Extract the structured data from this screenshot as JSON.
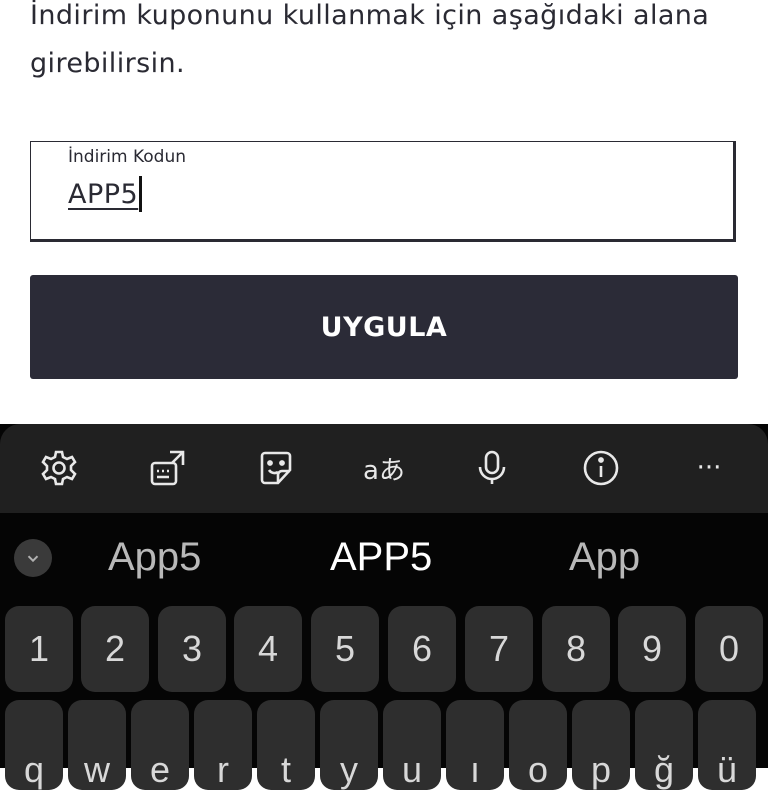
{
  "description": "İndirim kuponunu kullanmak için aşağıdaki alana girebilirsin.",
  "coupon_field": {
    "label": "İndirim Kodun",
    "value": "APP5"
  },
  "apply_button": {
    "label": "UYGULA"
  },
  "keyboard": {
    "toolbar": [
      "settings-icon",
      "keyboard-resize-icon",
      "sticker-icon",
      "translate-icon",
      "microphone-icon",
      "info-icon",
      "more-icon"
    ],
    "translate_label": "aあ",
    "more_label": "···",
    "suggestions": {
      "left": "App5",
      "center": "APP5",
      "right": "App"
    },
    "number_row": [
      "1",
      "2",
      "3",
      "4",
      "5",
      "6",
      "7",
      "8",
      "9",
      "0"
    ],
    "letter_row": [
      "q",
      "w",
      "e",
      "r",
      "t",
      "y",
      "u",
      "ı",
      "o",
      "p",
      "ğ",
      "ü"
    ]
  }
}
